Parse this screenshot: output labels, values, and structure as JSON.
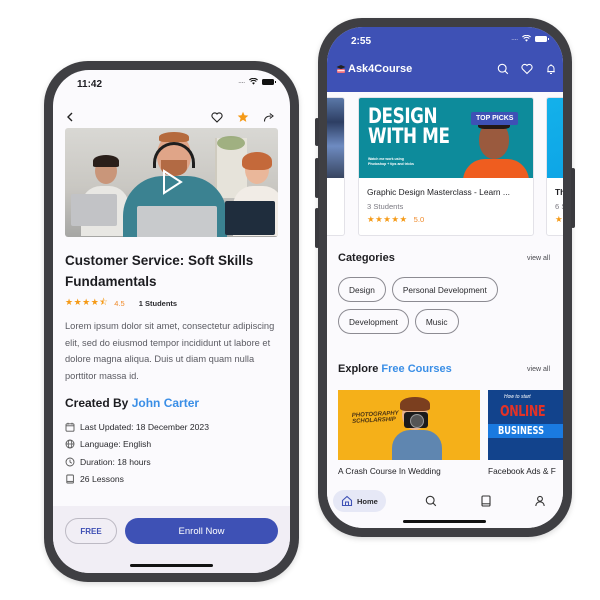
{
  "left_screen": {
    "status_bar": {
      "time": "11:42",
      "signal_dots": "....",
      "wifi_icon": "wifi-icon",
      "battery_icon": "battery-icon"
    },
    "nav": {
      "back_icon": "chevron-left-icon",
      "favorite_icon": "heart-icon",
      "star_icon": "star-icon",
      "share_icon": "share-icon"
    },
    "video": {
      "play_icon": "play-icon"
    },
    "course": {
      "title": "Customer Service: Soft Skills Fundamentals",
      "stars": "★★★★⯪",
      "rating": "4.5",
      "rating_value": 4.5,
      "rating_max": 5,
      "students": "1 Students",
      "description": "Lorem ipsum dolor sit amet, consectetur adipiscing elit, sed do eiusmod tempor incididunt ut labore et dolore magna aliqua. Duis ut diam quam nulla porttitor massa id.",
      "created_by_label": "Created By",
      "author": "John Carter",
      "meta": [
        {
          "icon": "calendar-icon",
          "text": "Last Updated: 18 December 2023"
        },
        {
          "icon": "globe-icon",
          "text": "Language: English"
        },
        {
          "icon": "clock-icon",
          "text": "Duration: 18 hours"
        },
        {
          "icon": "book-icon",
          "text": "26 Lessons"
        }
      ]
    },
    "actions": {
      "price_label": "FREE",
      "enroll_label": "Enroll Now"
    }
  },
  "right_screen": {
    "status_bar": {
      "time": "2:55",
      "signal_dots": "....",
      "wifi_icon": "wifi-icon",
      "battery_icon": "battery-icon"
    },
    "header": {
      "app_name": "Ask4Course",
      "logo_icon": "graduation-cap-icon",
      "icons": [
        "search-icon",
        "heart-icon",
        "bell-icon"
      ]
    },
    "featured": {
      "prev_card": {
        "title": "...",
        "students": ""
      },
      "main_card": {
        "thumb_heading_line1": "DESIGN",
        "thumb_heading_line2": "WITH ME",
        "thumb_subtext": "Watch me work using Photoshop + tips and tricks",
        "badge": "TOP PICKS",
        "title": "Graphic Design Masterclass - Learn ...",
        "students": "3 Students",
        "stars": "★★★★★",
        "rating": "5.0",
        "rating_value": 5.0
      },
      "next_card": {
        "title": "Th",
        "students": "6 S",
        "stars": "★"
      }
    },
    "categories": {
      "heading": "Categories",
      "view_all": "view all",
      "items": [
        "Design",
        "Personal Development",
        "Development",
        "Music"
      ]
    },
    "free_courses": {
      "heading_prefix": "Explore",
      "heading_accent": "Free Courses",
      "view_all": "view all",
      "items": [
        {
          "title": "A Crash Course In Wedding",
          "thumb_text": "PHOTOGRAPHY SCHOLARSHIP"
        },
        {
          "title": "Facebook Ads & F",
          "thumb_small": "How to start",
          "thumb_line1": "ONLINE",
          "thumb_line2": "BUSINESS"
        }
      ]
    },
    "tabbar": {
      "items": [
        {
          "icon": "home-icon",
          "label": "Home",
          "active": true
        },
        {
          "icon": "search-icon",
          "label": ""
        },
        {
          "icon": "book-icon",
          "label": ""
        },
        {
          "icon": "user-icon",
          "label": ""
        }
      ]
    }
  },
  "colors": {
    "primary": "#3e51b5",
    "accent_link": "#3a8ee6",
    "star": "#f59a17",
    "rating_text": "#ef8a2a"
  }
}
